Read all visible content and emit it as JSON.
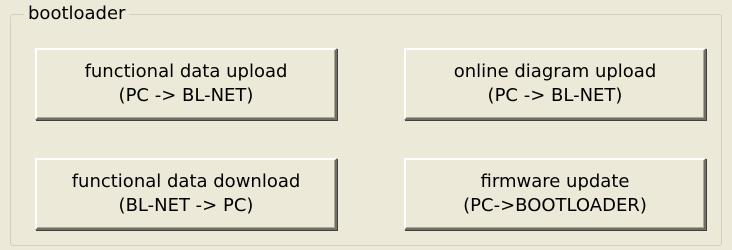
{
  "group": {
    "title": "bootloader"
  },
  "buttons": [
    {
      "line1": "functional data upload",
      "line2": "(PC -> BL-NET)"
    },
    {
      "line1": "online diagram upload",
      "line2": "(PC -> BL-NET)"
    },
    {
      "line1": "functional data download",
      "line2": "(BL-NET -> PC)"
    },
    {
      "line1": "firmware update",
      "line2": "(PC->BOOTLOADER)"
    }
  ]
}
